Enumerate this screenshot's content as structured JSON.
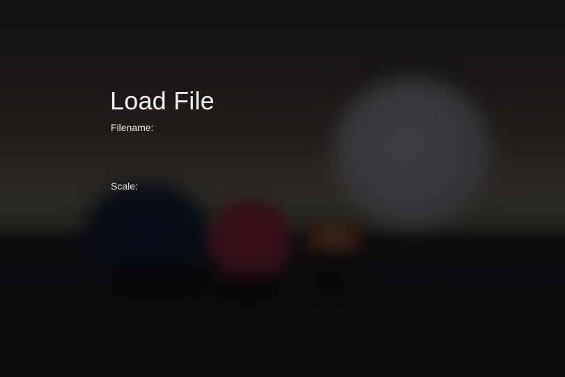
{
  "dialog": {
    "title": "Load File",
    "filename": {
      "label": "Filename:",
      "value": "",
      "placeholder": ""
    },
    "scale": {
      "label": "Scale:",
      "value": "",
      "placeholder": ""
    }
  },
  "scene": {
    "background_top": "#121011",
    "horizon_color": "#2b2a24",
    "floor_color": "#0c0b0e",
    "sphere_colors": {
      "grey": "#3f3d41",
      "blue": "#0a101c",
      "red": "#3d0d16",
      "orange": "#3a2418"
    }
  }
}
